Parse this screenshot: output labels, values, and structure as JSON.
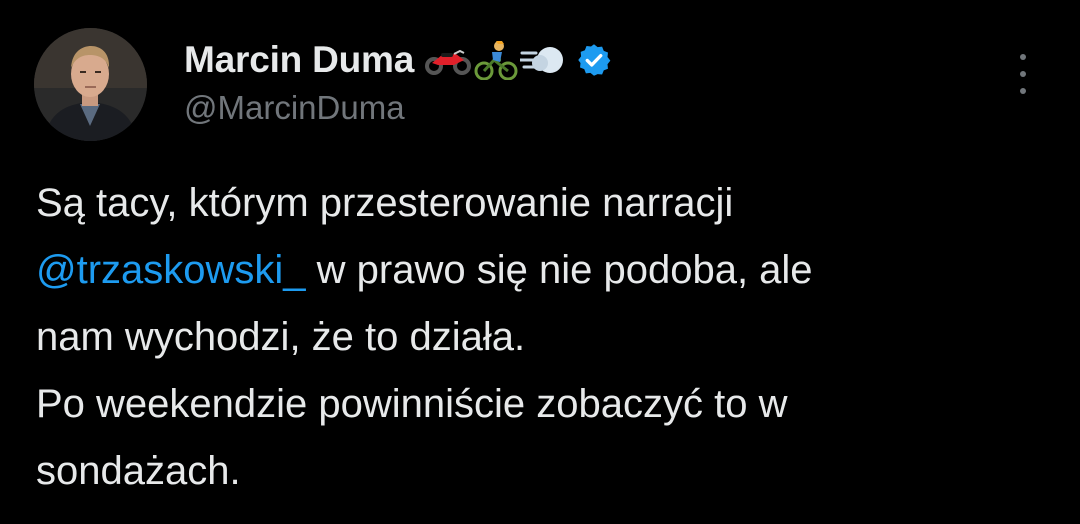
{
  "author": {
    "display_name": "Marcin Duma",
    "handle": "@MarcinDuma",
    "name_emojis": [
      "motorcycle-emoji",
      "cyclist-emoji",
      "dash-emoji"
    ],
    "verified": true,
    "verified_color": "#1d9bf0"
  },
  "menu": {
    "icon": "more-vertical-icon"
  },
  "tweet": {
    "line1": "Są tacy, którym przesterowanie narracji",
    "mention": "@trzaskowski_",
    "line2_rest": " w prawo się nie podoba, ale",
    "line3": "nam wychodzi, że to działa.",
    "line4": "Po weekendzie powinniście zobaczyć to w",
    "line5": "sondażach."
  },
  "colors": {
    "background": "#000000",
    "text": "#e7e9ea",
    "secondary": "#71767b",
    "link": "#1d9bf0"
  }
}
